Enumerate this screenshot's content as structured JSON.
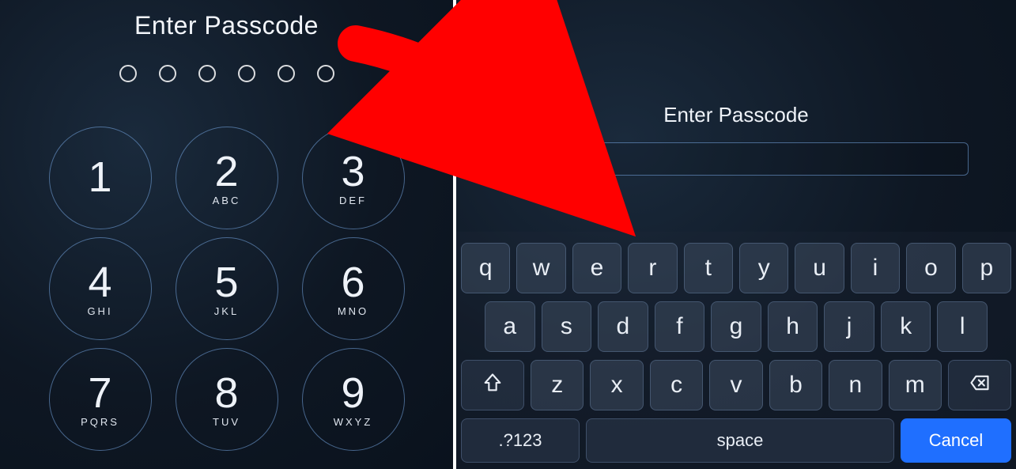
{
  "left": {
    "title": "Enter Passcode",
    "dot_count": 6,
    "keypad": [
      [
        {
          "digit": "1",
          "letters": ""
        },
        {
          "digit": "2",
          "letters": "ABC"
        },
        {
          "digit": "3",
          "letters": "DEF"
        }
      ],
      [
        {
          "digit": "4",
          "letters": "GHI"
        },
        {
          "digit": "5",
          "letters": "JKL"
        },
        {
          "digit": "6",
          "letters": "MNO"
        }
      ],
      [
        {
          "digit": "7",
          "letters": "PQRS"
        },
        {
          "digit": "8",
          "letters": "TUV"
        },
        {
          "digit": "9",
          "letters": "WXYZ"
        }
      ]
    ]
  },
  "right": {
    "title": "Enter Passcode",
    "field_value": "",
    "keyboard": {
      "row1": [
        "q",
        "w",
        "e",
        "r",
        "t",
        "y",
        "u",
        "i",
        "o",
        "p"
      ],
      "row2": [
        "a",
        "s",
        "d",
        "f",
        "g",
        "h",
        "j",
        "k",
        "l"
      ],
      "row3": [
        "z",
        "x",
        "c",
        "v",
        "b",
        "n",
        "m"
      ],
      "shift_icon": "shift-up-icon",
      "backspace_icon": "backspace-icon",
      "bottom": {
        "num_switch": ".?123",
        "space": "space",
        "cancel": "Cancel"
      }
    }
  },
  "arrow": {
    "color": "#ff0000"
  }
}
